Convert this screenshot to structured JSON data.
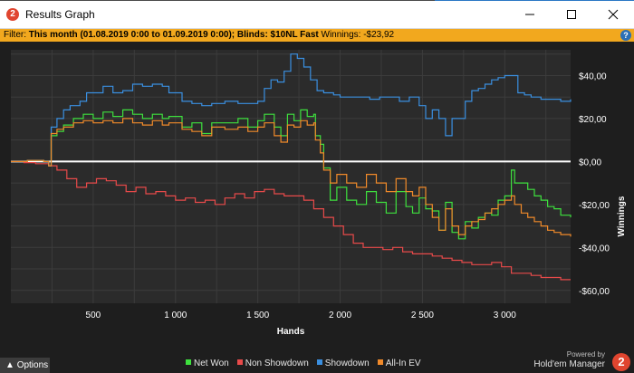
{
  "window": {
    "title": "Results Graph",
    "app_icon_glyph": "2"
  },
  "filter": {
    "prefix": "Filter:",
    "period": "This month (01.08.2019 0:00 to 01.09.2019 0:00); Blinds: $10NL Fast",
    "winnings_label": "Winnings:",
    "winnings_value": "-$23,92",
    "help_glyph": "?"
  },
  "chart_data": {
    "type": "line",
    "xlabel": "Hands",
    "ylabel": "Winnings",
    "xlim": [
      0,
      3400
    ],
    "ylim": [
      -66,
      52
    ],
    "x_ticks": [
      500,
      1000,
      1500,
      2000,
      2500,
      3000
    ],
    "x_tick_labels": [
      "500",
      "1 000",
      "1 500",
      "2 000",
      "2 500",
      "3 000"
    ],
    "y_ticks": [
      40,
      20,
      0,
      -20,
      -40,
      -60
    ],
    "y_tick_labels": [
      "$40,00",
      "$20,00",
      "$0,00",
      "-$20,00",
      "-$40,00",
      "-$60,00"
    ],
    "grid": true,
    "zero_line": true,
    "legend_placement": "bottom-center",
    "series": [
      {
        "name": "Net Won",
        "color": "#3ee03e",
        "points": [
          [
            0,
            0
          ],
          [
            100,
            0.5
          ],
          [
            200,
            0
          ],
          [
            230,
            -2
          ],
          [
            245,
            12
          ],
          [
            280,
            14
          ],
          [
            320,
            17
          ],
          [
            380,
            20
          ],
          [
            440,
            22
          ],
          [
            500,
            20
          ],
          [
            560,
            23
          ],
          [
            620,
            21
          ],
          [
            680,
            24
          ],
          [
            740,
            22
          ],
          [
            800,
            20
          ],
          [
            860,
            22
          ],
          [
            920,
            20
          ],
          [
            960,
            21
          ],
          [
            1040,
            16
          ],
          [
            1100,
            18
          ],
          [
            1160,
            13
          ],
          [
            1220,
            18
          ],
          [
            1300,
            18
          ],
          [
            1380,
            20
          ],
          [
            1440,
            16
          ],
          [
            1500,
            19
          ],
          [
            1540,
            22
          ],
          [
            1600,
            16
          ],
          [
            1640,
            12
          ],
          [
            1680,
            22
          ],
          [
            1720,
            19
          ],
          [
            1760,
            24
          ],
          [
            1800,
            21
          ],
          [
            1840,
            22
          ],
          [
            1850,
            12
          ],
          [
            1880,
            8
          ],
          [
            1900,
            -3
          ],
          [
            1940,
            -18
          ],
          [
            1980,
            -12
          ],
          [
            2040,
            -18
          ],
          [
            2100,
            -20
          ],
          [
            2160,
            -14
          ],
          [
            2220,
            -19
          ],
          [
            2280,
            -24
          ],
          [
            2340,
            -14
          ],
          [
            2400,
            -21
          ],
          [
            2440,
            -24
          ],
          [
            2480,
            -17
          ],
          [
            2520,
            -22
          ],
          [
            2560,
            -23
          ],
          [
            2600,
            -32
          ],
          [
            2640,
            -19
          ],
          [
            2680,
            -33
          ],
          [
            2720,
            -36
          ],
          [
            2760,
            -28
          ],
          [
            2800,
            -31
          ],
          [
            2840,
            -26
          ],
          [
            2880,
            -24
          ],
          [
            2920,
            -25
          ],
          [
            2960,
            -18
          ],
          [
            3000,
            -16
          ],
          [
            3040,
            -4
          ],
          [
            3060,
            -10
          ],
          [
            3100,
            -10
          ],
          [
            3140,
            -13
          ],
          [
            3180,
            -16
          ],
          [
            3220,
            -18
          ],
          [
            3260,
            -21
          ],
          [
            3300,
            -22
          ],
          [
            3340,
            -25
          ],
          [
            3400,
            -26
          ]
        ]
      },
      {
        "name": "Non Showdown",
        "color": "#e84a4a",
        "points": [
          [
            0,
            0
          ],
          [
            80,
            -0.5
          ],
          [
            150,
            -1
          ],
          [
            230,
            -2
          ],
          [
            280,
            -4
          ],
          [
            340,
            -8
          ],
          [
            400,
            -12
          ],
          [
            460,
            -10
          ],
          [
            520,
            -8
          ],
          [
            580,
            -9
          ],
          [
            640,
            -11
          ],
          [
            700,
            -14
          ],
          [
            760,
            -12
          ],
          [
            820,
            -15
          ],
          [
            880,
            -14
          ],
          [
            940,
            -16
          ],
          [
            1000,
            -18
          ],
          [
            1060,
            -17
          ],
          [
            1120,
            -19
          ],
          [
            1180,
            -18
          ],
          [
            1240,
            -20
          ],
          [
            1300,
            -17
          ],
          [
            1360,
            -15
          ],
          [
            1420,
            -17
          ],
          [
            1480,
            -14
          ],
          [
            1540,
            -13
          ],
          [
            1600,
            -15
          ],
          [
            1660,
            -16
          ],
          [
            1720,
            -16
          ],
          [
            1780,
            -18
          ],
          [
            1840,
            -22
          ],
          [
            1900,
            -26
          ],
          [
            1960,
            -30
          ],
          [
            2020,
            -34
          ],
          [
            2080,
            -38
          ],
          [
            2140,
            -40
          ],
          [
            2200,
            -40
          ],
          [
            2260,
            -41
          ],
          [
            2320,
            -40
          ],
          [
            2380,
            -42
          ],
          [
            2440,
            -43
          ],
          [
            2500,
            -43
          ],
          [
            2560,
            -44
          ],
          [
            2620,
            -45
          ],
          [
            2680,
            -46
          ],
          [
            2740,
            -47
          ],
          [
            2800,
            -48
          ],
          [
            2860,
            -48
          ],
          [
            2920,
            -47
          ],
          [
            2980,
            -49
          ],
          [
            3040,
            -52
          ],
          [
            3100,
            -52
          ],
          [
            3160,
            -53
          ],
          [
            3220,
            -54
          ],
          [
            3280,
            -54
          ],
          [
            3340,
            -55
          ],
          [
            3400,
            -55
          ]
        ]
      },
      {
        "name": "Showdown",
        "color": "#3a8fe0",
        "points": [
          [
            0,
            0
          ],
          [
            100,
            0.5
          ],
          [
            200,
            0
          ],
          [
            230,
            -2
          ],
          [
            245,
            16
          ],
          [
            280,
            20
          ],
          [
            320,
            24
          ],
          [
            360,
            26
          ],
          [
            420,
            28
          ],
          [
            460,
            32
          ],
          [
            520,
            32
          ],
          [
            560,
            35
          ],
          [
            620,
            32
          ],
          [
            680,
            33
          ],
          [
            740,
            36
          ],
          [
            800,
            35
          ],
          [
            860,
            36
          ],
          [
            920,
            35
          ],
          [
            960,
            32
          ],
          [
            1040,
            28
          ],
          [
            1100,
            27
          ],
          [
            1160,
            26
          ],
          [
            1220,
            27
          ],
          [
            1300,
            28
          ],
          [
            1380,
            27
          ],
          [
            1440,
            27
          ],
          [
            1500,
            28
          ],
          [
            1540,
            34
          ],
          [
            1580,
            38
          ],
          [
            1620,
            37
          ],
          [
            1660,
            42
          ],
          [
            1700,
            50
          ],
          [
            1740,
            48
          ],
          [
            1780,
            44
          ],
          [
            1820,
            38
          ],
          [
            1860,
            33
          ],
          [
            1900,
            32
          ],
          [
            1960,
            31
          ],
          [
            2000,
            30
          ],
          [
            2060,
            30
          ],
          [
            2120,
            30
          ],
          [
            2180,
            29
          ],
          [
            2240,
            30
          ],
          [
            2300,
            30
          ],
          [
            2360,
            28
          ],
          [
            2420,
            30
          ],
          [
            2480,
            26
          ],
          [
            2520,
            20
          ],
          [
            2560,
            24
          ],
          [
            2600,
            20
          ],
          [
            2640,
            12
          ],
          [
            2680,
            20
          ],
          [
            2720,
            20
          ],
          [
            2760,
            28
          ],
          [
            2800,
            33
          ],
          [
            2840,
            34
          ],
          [
            2880,
            36
          ],
          [
            2920,
            38
          ],
          [
            2960,
            39
          ],
          [
            3000,
            40
          ],
          [
            3040,
            40
          ],
          [
            3080,
            32
          ],
          [
            3120,
            31
          ],
          [
            3160,
            30
          ],
          [
            3220,
            29
          ],
          [
            3280,
            29
          ],
          [
            3340,
            28
          ],
          [
            3400,
            29
          ]
        ]
      },
      {
        "name": "All-In EV",
        "color": "#f08a2a",
        "points": [
          [
            0,
            0
          ],
          [
            100,
            0.5
          ],
          [
            200,
            0
          ],
          [
            230,
            -2
          ],
          [
            245,
            13
          ],
          [
            280,
            15
          ],
          [
            320,
            16
          ],
          [
            380,
            18
          ],
          [
            440,
            19
          ],
          [
            500,
            18
          ],
          [
            560,
            19
          ],
          [
            620,
            18
          ],
          [
            680,
            20
          ],
          [
            740,
            18
          ],
          [
            800,
            17
          ],
          [
            860,
            19
          ],
          [
            920,
            17
          ],
          [
            960,
            18
          ],
          [
            1040,
            15
          ],
          [
            1100,
            14
          ],
          [
            1160,
            12
          ],
          [
            1220,
            16
          ],
          [
            1300,
            15
          ],
          [
            1380,
            16
          ],
          [
            1440,
            14
          ],
          [
            1500,
            16
          ],
          [
            1540,
            18
          ],
          [
            1600,
            12
          ],
          [
            1640,
            9
          ],
          [
            1680,
            17
          ],
          [
            1720,
            16
          ],
          [
            1760,
            19
          ],
          [
            1800,
            17
          ],
          [
            1840,
            18
          ],
          [
            1850,
            10
          ],
          [
            1880,
            4
          ],
          [
            1900,
            -4
          ],
          [
            1940,
            -10
          ],
          [
            1980,
            -6
          ],
          [
            2040,
            -10
          ],
          [
            2100,
            -12
          ],
          [
            2160,
            -6
          ],
          [
            2220,
            -10
          ],
          [
            2280,
            -14
          ],
          [
            2340,
            -8
          ],
          [
            2400,
            -14
          ],
          [
            2440,
            -16
          ],
          [
            2480,
            -12
          ],
          [
            2520,
            -20
          ],
          [
            2560,
            -26
          ],
          [
            2600,
            -32
          ],
          [
            2640,
            -22
          ],
          [
            2680,
            -30
          ],
          [
            2720,
            -34
          ],
          [
            2760,
            -30
          ],
          [
            2800,
            -28
          ],
          [
            2840,
            -27
          ],
          [
            2880,
            -24
          ],
          [
            2920,
            -22
          ],
          [
            2960,
            -20
          ],
          [
            3000,
            -18
          ],
          [
            3040,
            -16
          ],
          [
            3060,
            -20
          ],
          [
            3100,
            -24
          ],
          [
            3140,
            -26
          ],
          [
            3180,
            -28
          ],
          [
            3220,
            -30
          ],
          [
            3260,
            -32
          ],
          [
            3300,
            -33
          ],
          [
            3340,
            -34
          ],
          [
            3400,
            -35
          ]
        ]
      }
    ]
  },
  "bottom": {
    "options_label": "Options",
    "powered_by": "Powered by",
    "brand_name": "Hold'em Manager",
    "brand_glyph": "2"
  }
}
